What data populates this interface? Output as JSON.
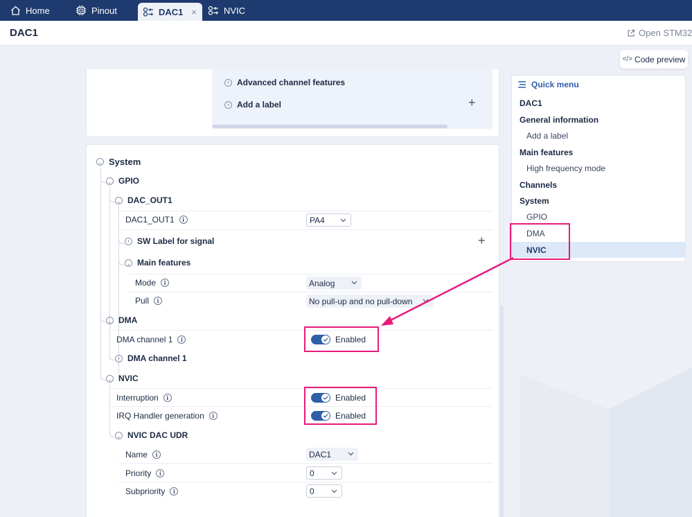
{
  "tabs": [
    {
      "label": "Home",
      "icon": "home-icon"
    },
    {
      "label": "Pinout",
      "icon": "chip-icon"
    },
    {
      "label": "DAC1",
      "icon": "peripheral-icon",
      "active": true,
      "close": "×"
    },
    {
      "label": "NVIC",
      "icon": "peripheral-icon"
    }
  ],
  "header": {
    "title": "DAC1",
    "open_link": "Open STM32"
  },
  "code_preview": {
    "label": "Code preview",
    "icon": "</>"
  },
  "top_card": {
    "advanced_label": "Advanced channel features",
    "add_label": "Add a label",
    "plus": "+"
  },
  "system": {
    "title": "System",
    "gpio": {
      "title": "GPIO",
      "dac_out1": {
        "title": "DAC_OUT1",
        "field_label": "DAC1_OUT1",
        "field_value": "PA4",
        "sw_label": "SW Label for signal",
        "main_features": "Main features",
        "mode_label": "Mode",
        "mode_value": "Analog",
        "pull_label": "Pull",
        "pull_value": "No pull-up and no pull-down"
      }
    },
    "dma": {
      "title": "DMA",
      "channel_label": "DMA channel 1",
      "channel_state": "Enabled",
      "channel_group": "DMA channel 1"
    },
    "nvic": {
      "title": "NVIC",
      "interruption_label": "Interruption",
      "interruption_state": "Enabled",
      "irq_label": "IRQ Handler generation",
      "irq_state": "Enabled",
      "udr": {
        "title": "NVIC DAC UDR",
        "name_label": "Name",
        "name_value": "DAC1",
        "priority_label": "Priority",
        "priority_value": "0",
        "subpriority_label": "Subpriority",
        "subpriority_value": "0"
      }
    }
  },
  "quick_menu": {
    "title": "Quick menu",
    "items": [
      {
        "label": "DAC1",
        "level": "section"
      },
      {
        "label": "General information",
        "level": "section"
      },
      {
        "label": "Add a label",
        "level": "sub"
      },
      {
        "label": "Main features",
        "level": "section"
      },
      {
        "label": "High frequency mode",
        "level": "sub"
      },
      {
        "label": "Channels",
        "level": "section"
      },
      {
        "label": "System",
        "level": "section"
      },
      {
        "label": "GPIO",
        "level": "sub"
      },
      {
        "label": "DMA",
        "level": "sub"
      },
      {
        "label": "NVIC",
        "level": "sub",
        "active": true
      }
    ]
  },
  "colors": {
    "tabbar": "#1e3a6e",
    "accent": "#2f5fa8",
    "highlight": "#e8197a"
  }
}
